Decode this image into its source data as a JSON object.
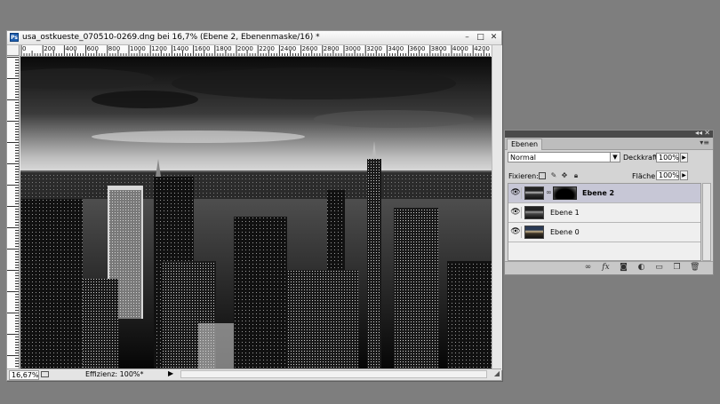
{
  "document": {
    "title": "usa_ostkueste_070510-0269.dng bei 16,7% (Ebene 2, Ebenenmaske/16) *",
    "app_icon": "Ps",
    "window_buttons": {
      "minimize": "–",
      "maximize": "□",
      "close": "✕"
    },
    "ruler_top": [
      "0",
      "200",
      "400",
      "600",
      "800",
      "1000",
      "1200",
      "1400",
      "1600",
      "1800",
      "2000",
      "2200",
      "2400",
      "2600",
      "2800",
      "3000",
      "3200",
      "3400",
      "3600",
      "3800",
      "4000",
      "4200"
    ],
    "status": {
      "zoom": "16,67%",
      "info": "Effizienz: 100%*",
      "info_arrow": "▶"
    },
    "image_icon": "cityscape-photo"
  },
  "layers_panel": {
    "tab": "Ebenen",
    "blend_mode": "Normal",
    "opacity_label": "Deckkraft:",
    "opacity_value": "100%",
    "lock_label": "Fixieren:",
    "fill_label": "Fläche:",
    "fill_value": "100%",
    "layers": [
      {
        "name": "Ebene 2",
        "selected": true,
        "has_mask": true
      },
      {
        "name": "Ebene 1",
        "selected": false,
        "has_mask": false
      },
      {
        "name": "Ebene 0",
        "selected": false,
        "has_mask": false
      }
    ],
    "bottom_icons": [
      "link-icon",
      "fx-icon",
      "mask-icon",
      "adjustment-icon",
      "group-icon",
      "new-layer-icon",
      "trash-icon"
    ]
  }
}
